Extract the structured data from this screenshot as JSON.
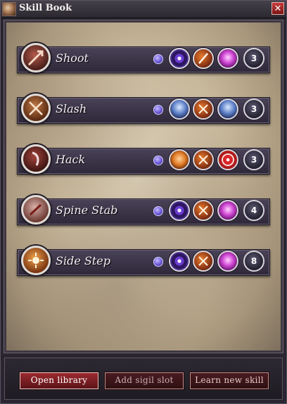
{
  "window": {
    "title": "Skill Book",
    "close_glyph": "✕"
  },
  "skills": [
    {
      "name": "Shoot",
      "count": "3",
      "sigils": [
        "eye-sigil-icon",
        "blade-sigil-icon",
        "magenta-figure-sigil-icon"
      ]
    },
    {
      "name": "Slash",
      "count": "3",
      "sigils": [
        "blue-spirit-sigil-icon",
        "crossed-swords-sigil-icon",
        "blue-ghost-sigil-icon"
      ]
    },
    {
      "name": "Hack",
      "count": "3",
      "sigils": [
        "orange-figure-sigil-icon",
        "crossed-swords-sigil-icon",
        "red-ring-sigil-icon"
      ]
    },
    {
      "name": "Spine Stab",
      "count": "4",
      "sigils": [
        "eye-sigil-icon",
        "crossed-swords-sigil-icon",
        "magenta-figure-sigil-icon"
      ]
    },
    {
      "name": "Side Step",
      "count": "8",
      "sigils": [
        "eye-sigil-icon",
        "crossed-swords-sigil-icon",
        "magenta-figure-sigil-icon"
      ]
    }
  ],
  "footer": {
    "open_library": "Open library",
    "add_sigil_slot": "Add sigil slot",
    "learn_new_skill": "Learn new skill"
  },
  "colors": {
    "row_top": "#4a4257",
    "row_bottom": "#2e2839",
    "primary_button": "#9a2a2f",
    "toggle": "#6c58d8"
  }
}
